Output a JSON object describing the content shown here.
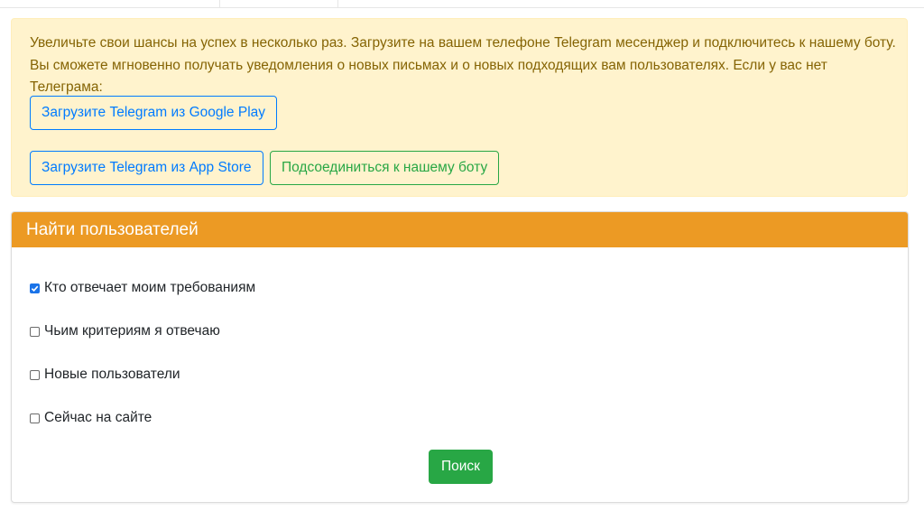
{
  "telegram_alert": {
    "message": "Увеличьте свои шансы на успех в несколько раз. Загрузите на вашем телефоне Telegram месенджер и подключитесь к нашему боту. Вы сможете мгновенно получать уведомления о новых письмах и о новых подходящих вам пользователях. Если у вас нет Телеграма:",
    "google_play_label": "Загрузите Telegram из Google Play",
    "app_store_label": "Загрузите Telegram из App Store",
    "bot_label": "Подсоединиться к нашему боту"
  },
  "search_card": {
    "title": "Найти пользователей",
    "options": [
      {
        "label": "Кто отвечает моим требованиям",
        "checked": true
      },
      {
        "label": "Чьим критериям я отвечаю",
        "checked": false
      },
      {
        "label": "Новые пользователи",
        "checked": false
      },
      {
        "label": "Сейчас на сайте",
        "checked": false
      }
    ],
    "search_label": "Поиск"
  },
  "colors": {
    "alert_bg": "#fff3cd",
    "alert_text": "#856404",
    "header_accent": "#ec9a24",
    "primary_blue": "#007bff",
    "success_green": "#28a745"
  }
}
